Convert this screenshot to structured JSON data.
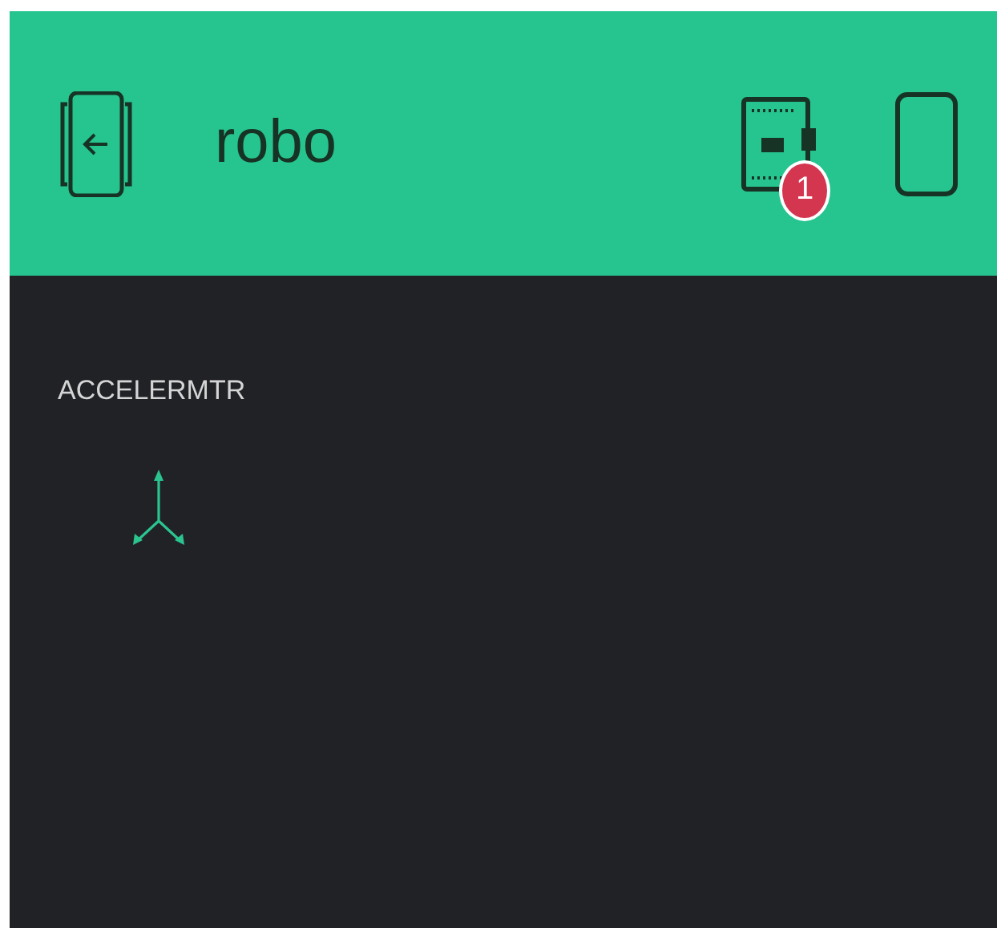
{
  "header": {
    "title": "robo",
    "device_badge": "1"
  },
  "widgets": [
    {
      "kind": "accelerometer",
      "label": "ACCELERMTR"
    }
  ]
}
